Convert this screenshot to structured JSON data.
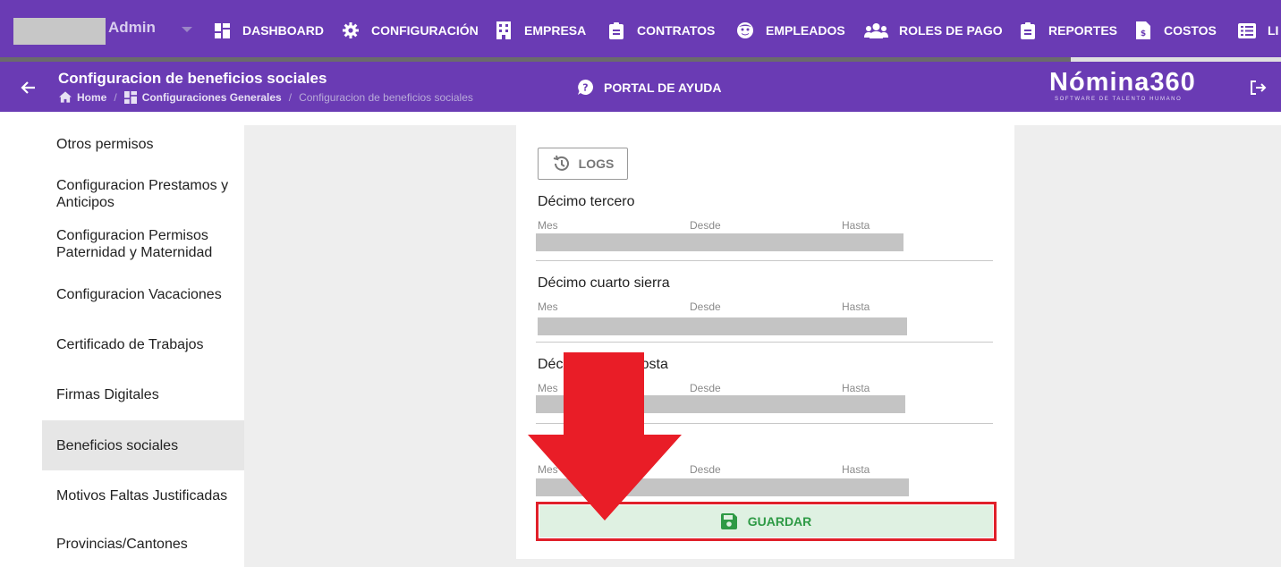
{
  "topbar": {
    "user_name": "Admin",
    "nav": [
      {
        "label": "DASHBOARD",
        "icon": "dashboard-icon"
      },
      {
        "label": "CONFIGURACIÓN",
        "icon": "gear-icon"
      },
      {
        "label": "EMPRESA",
        "icon": "building-icon"
      },
      {
        "label": "CONTRATOS",
        "icon": "clipboard-icon"
      },
      {
        "label": "EMPLEADOS",
        "icon": "face-icon"
      },
      {
        "label": "ROLES DE PAGO",
        "icon": "users-icon"
      },
      {
        "label": "REPORTES",
        "icon": "clipboard-list-icon"
      },
      {
        "label": "COSTOS",
        "icon": "file-dollar-icon"
      },
      {
        "label": "LI",
        "icon": "list-icon"
      }
    ]
  },
  "header": {
    "title": "Configuracion de beneficios sociales",
    "breadcrumb": {
      "home": "Home",
      "sep": "/",
      "section": "Configuraciones Generales",
      "current": "Configuracion de beneficios sociales"
    },
    "help": "PORTAL DE AYUDA",
    "brand": "Nómina360",
    "brand_tagline": "SOFTWARE DE TALENTO HUMANO"
  },
  "sidebar": {
    "items": [
      {
        "label": "Otros permisos"
      },
      {
        "label": "Configuracion Prestamos y Anticipos"
      },
      {
        "label": "Configuracion Permisos Paternidad y Maternidad"
      },
      {
        "label": "Configuracion Vacaciones"
      },
      {
        "label": "Certificado de Trabajos"
      },
      {
        "label": "Firmas Digitales"
      },
      {
        "label": "Beneficios sociales",
        "active": true
      },
      {
        "label": "Motivos Faltas Justificadas"
      },
      {
        "label": "Provincias/Cantones"
      }
    ]
  },
  "main": {
    "logs_label": "LOGS",
    "sections": [
      {
        "title": "Décimo tercero",
        "col_mes": "Mes",
        "col_desde": "Desde",
        "col_hasta": "Hasta"
      },
      {
        "title": "Décimo cuarto sierra",
        "col_mes": "Mes",
        "col_desde": "Desde",
        "col_hasta": "Hasta"
      },
      {
        "title": "Décimo cuarto costa",
        "col_mes": "Mes",
        "col_desde": "Desde",
        "col_hasta": "Hasta"
      },
      {
        "title": "",
        "col_mes": "Mes",
        "col_desde": "Desde",
        "col_hasta": "Hasta"
      }
    ],
    "save_label": "GUARDAR"
  },
  "colors": {
    "brand_purple": "#6a3bb4",
    "save_green": "#2e9a45",
    "highlight_red": "#e0202a"
  }
}
